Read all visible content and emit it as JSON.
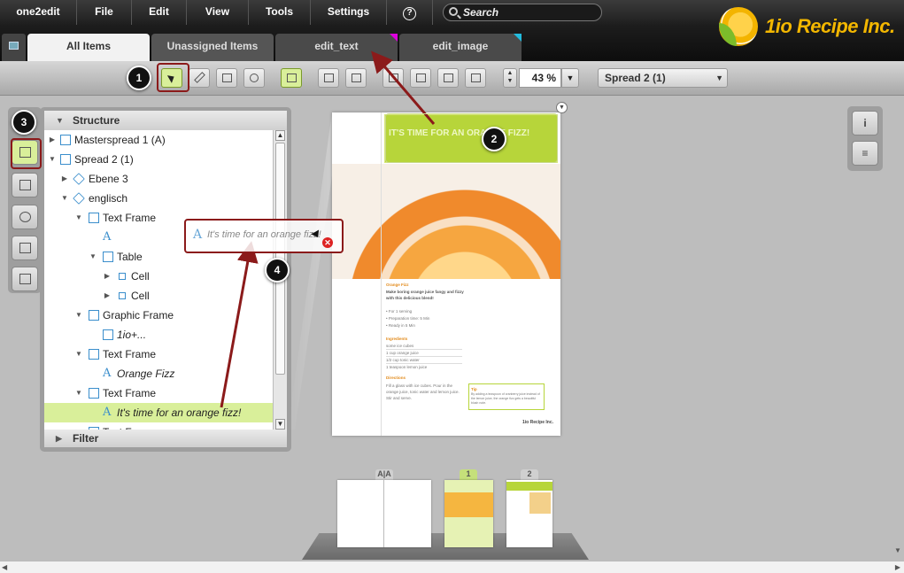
{
  "menu": {
    "app": "one2edit",
    "file": "File",
    "edit": "Edit",
    "view": "View",
    "tools": "Tools",
    "settings": "Settings",
    "help_icon": "?",
    "search_placeholder": "Search"
  },
  "logo": {
    "text": "1io Recipe Inc."
  },
  "tabs": [
    {
      "label": "All Items"
    },
    {
      "label": "Unassigned Items"
    },
    {
      "label": "edit_text"
    },
    {
      "label": "edit_image"
    }
  ],
  "toolbar": {
    "zoom_value": "43 %",
    "spread_value": "Spread 2 (1)"
  },
  "structure": {
    "title": "Structure",
    "filter_label": "Filter",
    "rows": [
      {
        "label": "Masterspread 1 (A)"
      },
      {
        "label": "Spread 2 (1)"
      },
      {
        "label": "Ebene 3"
      },
      {
        "label": "englisch"
      },
      {
        "label": "Text Frame"
      },
      {
        "label": "A"
      },
      {
        "label": "Table"
      },
      {
        "label": "Cell"
      },
      {
        "label": "Cell"
      },
      {
        "label": "Graphic Frame"
      },
      {
        "label": "1io+..."
      },
      {
        "label": "Text Frame"
      },
      {
        "label": "Orange Fizz"
      },
      {
        "label": "Text Frame"
      },
      {
        "label": "It's time for an  orange fizz!"
      },
      {
        "label": "Text Frame"
      }
    ]
  },
  "drag_ghost": {
    "icon": "A",
    "text": "It's time for an  orange fizz!"
  },
  "page": {
    "headline": "It's time for an orange fizz!",
    "recipe_title": "Orange Fizz",
    "intro": "Make boring orange juice fangy and fizzy with this delicious blend!",
    "serving": "• For 1 serving",
    "prep": "• Preparation time: 5 Min",
    "ready": "• Ready in 5 Min",
    "ingredients_h": "Ingredients",
    "ing1": "some          ice cubes",
    "ing2": "1 cup          orange juice",
    "ing3": "1/2 cup       tonic water",
    "ing4": "1 teaspoon  lemon juice",
    "directions_h": "Directions",
    "directions": "Fill a glass with ice cubes. Pour in the orange juice, tonic water and lemon juice. Stir and serve.",
    "tip_h": "Tip",
    "tip": "By adding a teaspoon of cranberry juice instead of the lemon juice, the orange fizz gets a beautiful blush note.",
    "footer_logo": "1io Recipe Inc."
  },
  "thumbs": {
    "master_label": "A|A",
    "p1_label": "1",
    "p2_label": "2"
  },
  "callouts": [
    "1",
    "2",
    "3",
    "4"
  ],
  "colors": {
    "accent": "#d9ef9a",
    "annotation": "#8b1a1a",
    "brand": "#f3b700"
  }
}
